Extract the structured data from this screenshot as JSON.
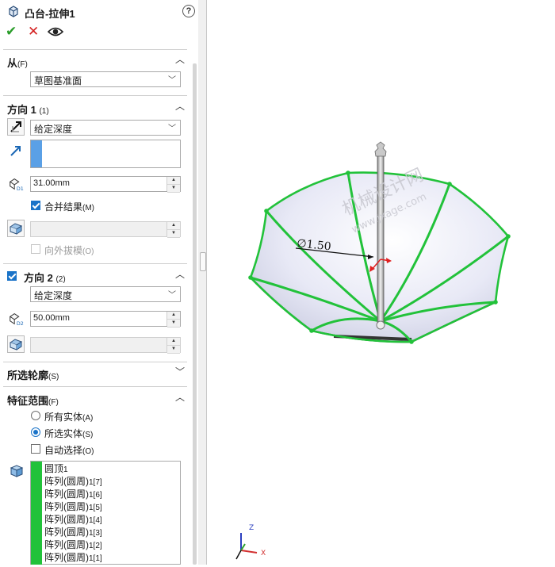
{
  "title": "凸台-拉伸1",
  "help": "?",
  "actions": {
    "ok": "✔",
    "cancel": "✕"
  },
  "from": {
    "label": "从",
    "hotkey": "(F)",
    "value": "草图基准面"
  },
  "dir1": {
    "label": "方向 1",
    "hotkey": "(1)",
    "end_condition": "给定深度",
    "depth": "31.00mm",
    "merge_label": "合并结果",
    "merge_hotkey": "(M)",
    "merge_checked": true,
    "draft_outward_label": "向外拔模",
    "draft_outward_hotkey": "(O)"
  },
  "dir2": {
    "label": "方向 2",
    "hotkey": "(2)",
    "enabled": true,
    "end_condition": "给定深度",
    "depth": "50.00mm"
  },
  "selected_contours": {
    "label": "所选轮廓",
    "hotkey": "(S)"
  },
  "feature_scope": {
    "label": "特征范围",
    "hotkey": "(F)",
    "options": [
      {
        "label": "所有实体",
        "hotkey": "(A)",
        "selected": false
      },
      {
        "label": "所选实体",
        "hotkey": "(S)",
        "selected": true
      }
    ],
    "auto_select_label": "自动选择",
    "auto_select_hotkey": "(O)",
    "bodies": [
      {
        "name": "圆顶",
        "suffix": "1"
      },
      {
        "name": "阵列(圆周)",
        "suffix": "1[7]"
      },
      {
        "name": "阵列(圆周)",
        "suffix": "1[6]"
      },
      {
        "name": "阵列(圆周)",
        "suffix": "1[5]"
      },
      {
        "name": "阵列(圆周)",
        "suffix": "1[4]"
      },
      {
        "name": "阵列(圆周)",
        "suffix": "1[3]"
      },
      {
        "name": "阵列(圆周)",
        "suffix": "1[2]"
      },
      {
        "name": "阵列(圆周)",
        "suffix": "1[1]"
      }
    ]
  },
  "viewport": {
    "dimension_label": "∅1.50",
    "watermark_line1": "机械设计网",
    "watermark_line2": "www.jxage.com",
    "triad": {
      "x": "X",
      "z": "Z"
    }
  },
  "colors": {
    "accent": "#1a73c8",
    "rib_green": "#22c23a",
    "ok_green": "#2a9d2a",
    "cancel_red": "#d42020"
  }
}
